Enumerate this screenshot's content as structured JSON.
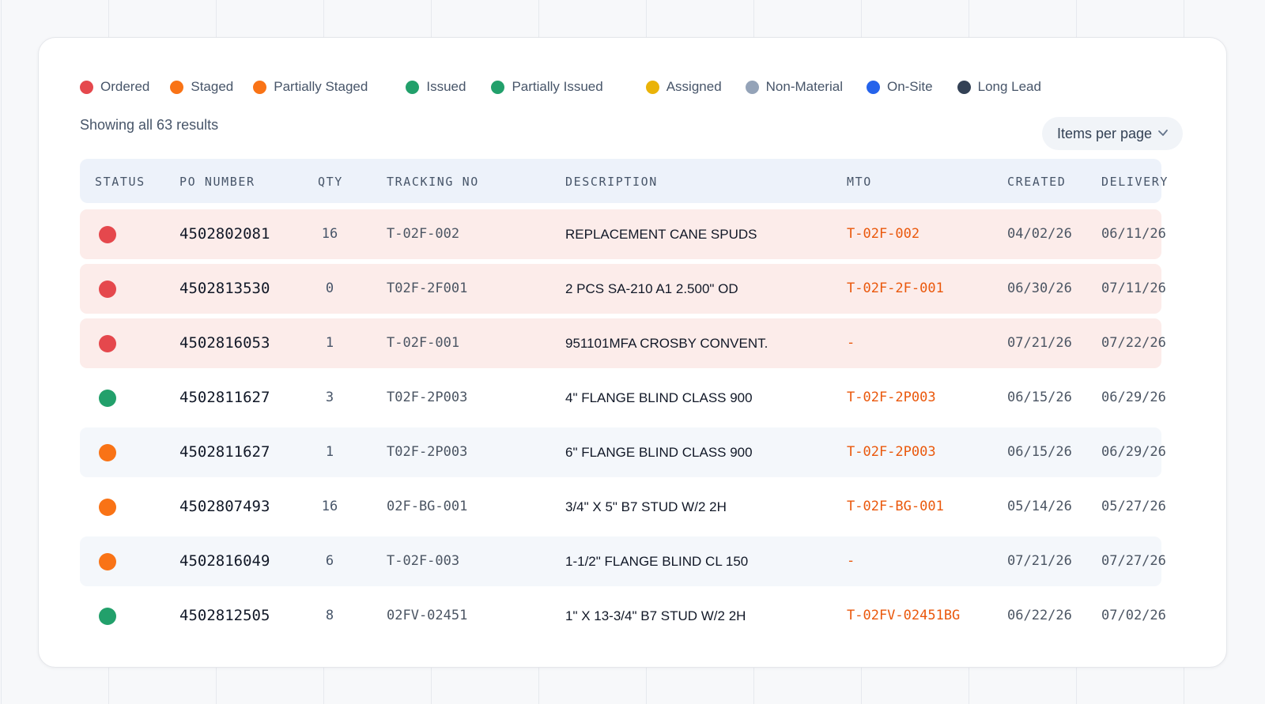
{
  "legend": [
    {
      "label": "Ordered",
      "color": "#e5484d",
      "icon": "status-dot-icon"
    },
    {
      "label": "Staged",
      "color": "#f97316",
      "icon": "status-dot-icon"
    },
    {
      "label": "Partially Staged",
      "color": "#f97316",
      "icon": "status-dot-icon"
    },
    {
      "label": "Issued",
      "color": "#22a06b",
      "icon": "status-dot-icon"
    },
    {
      "label": "Partially Issued",
      "color": "#22a06b",
      "icon": "status-dot-icon"
    },
    {
      "label": "Assigned",
      "color": "#eab308",
      "icon": "status-dot-icon"
    },
    {
      "label": "Non-Material",
      "color": "#94a3b8",
      "icon": "status-dot-icon"
    },
    {
      "label": "On-Site",
      "color": "#2563eb",
      "icon": "status-dot-icon"
    },
    {
      "label": "Long Lead",
      "color": "#334155",
      "icon": "status-dot-icon"
    }
  ],
  "results_text": "Showing all 63 results",
  "per_page": {
    "label": "Items per page",
    "icon": "chevron-down-icon"
  },
  "table": {
    "columns": {
      "status": "STATUS",
      "po_number": "PO NUMBER",
      "qty": "QTY",
      "tracking_no": "TRACKING NO",
      "description": "DESCRIPTION",
      "mto": "MTO",
      "created": "CREATED",
      "delivery": "DELIVERY"
    },
    "rows": [
      {
        "status_color": "#e5484d",
        "highlight": "#fcecea",
        "po_number": "4502802081",
        "qty": "16",
        "tracking_no": "T-02F-002",
        "description": "REPLACEMENT CANE SPUDS",
        "mto": "T-02F-002",
        "created": "04/02/26",
        "delivery": "06/11/26"
      },
      {
        "status_color": "#e5484d",
        "highlight": "#fcecea",
        "po_number": "4502813530",
        "qty": "0",
        "tracking_no": "T02F-2F001",
        "description": "2 PCS SA-210 A1 2.500\" OD",
        "mto": "T-02F-2F-001",
        "created": "06/30/26",
        "delivery": "07/11/26"
      },
      {
        "status_color": "#e5484d",
        "highlight": "#fcecea",
        "po_number": "4502816053",
        "qty": "1",
        "tracking_no": "T-02F-001",
        "description": "951101MFA CROSBY CONVENT.",
        "mto": "-",
        "created": "07/21/26",
        "delivery": "07/22/26"
      },
      {
        "status_color": "#22a06b",
        "highlight": "#ffffff",
        "po_number": "4502811627",
        "qty": "3",
        "tracking_no": "T02F-2P003",
        "description": "4\" FLANGE BLIND CLASS 900",
        "mto": "T-02F-2P003",
        "created": "06/15/26",
        "delivery": "06/29/26"
      },
      {
        "status_color": "#f97316",
        "highlight": "#f4f7fb",
        "po_number": "4502811627",
        "qty": "1",
        "tracking_no": "T02F-2P003",
        "description": "6\" FLANGE BLIND CLASS 900",
        "mto": "T-02F-2P003",
        "created": "06/15/26",
        "delivery": "06/29/26"
      },
      {
        "status_color": "#f97316",
        "highlight": "#ffffff",
        "po_number": "4502807493",
        "qty": "16",
        "tracking_no": "02F-BG-001",
        "description": "3/4\" X 5\" B7 STUD W/2 2H",
        "mto": "T-02F-BG-001",
        "created": "05/14/26",
        "delivery": "05/27/26"
      },
      {
        "status_color": "#f97316",
        "highlight": "#f4f7fb",
        "po_number": "4502816049",
        "qty": "6",
        "tracking_no": "T-02F-003",
        "description": "1-1/2\" FLANGE BLIND CL 150",
        "mto": "-",
        "created": "07/21/26",
        "delivery": "07/27/26"
      },
      {
        "status_color": "#22a06b",
        "highlight": "#ffffff",
        "po_number": "4502812505",
        "qty": "8",
        "tracking_no": "02FV-02451",
        "description": "1\" X 13-3/4\" B7 STUD W/2 2H",
        "mto": "T-02FV-02451BG",
        "created": "06/22/26",
        "delivery": "07/02/26"
      }
    ]
  }
}
